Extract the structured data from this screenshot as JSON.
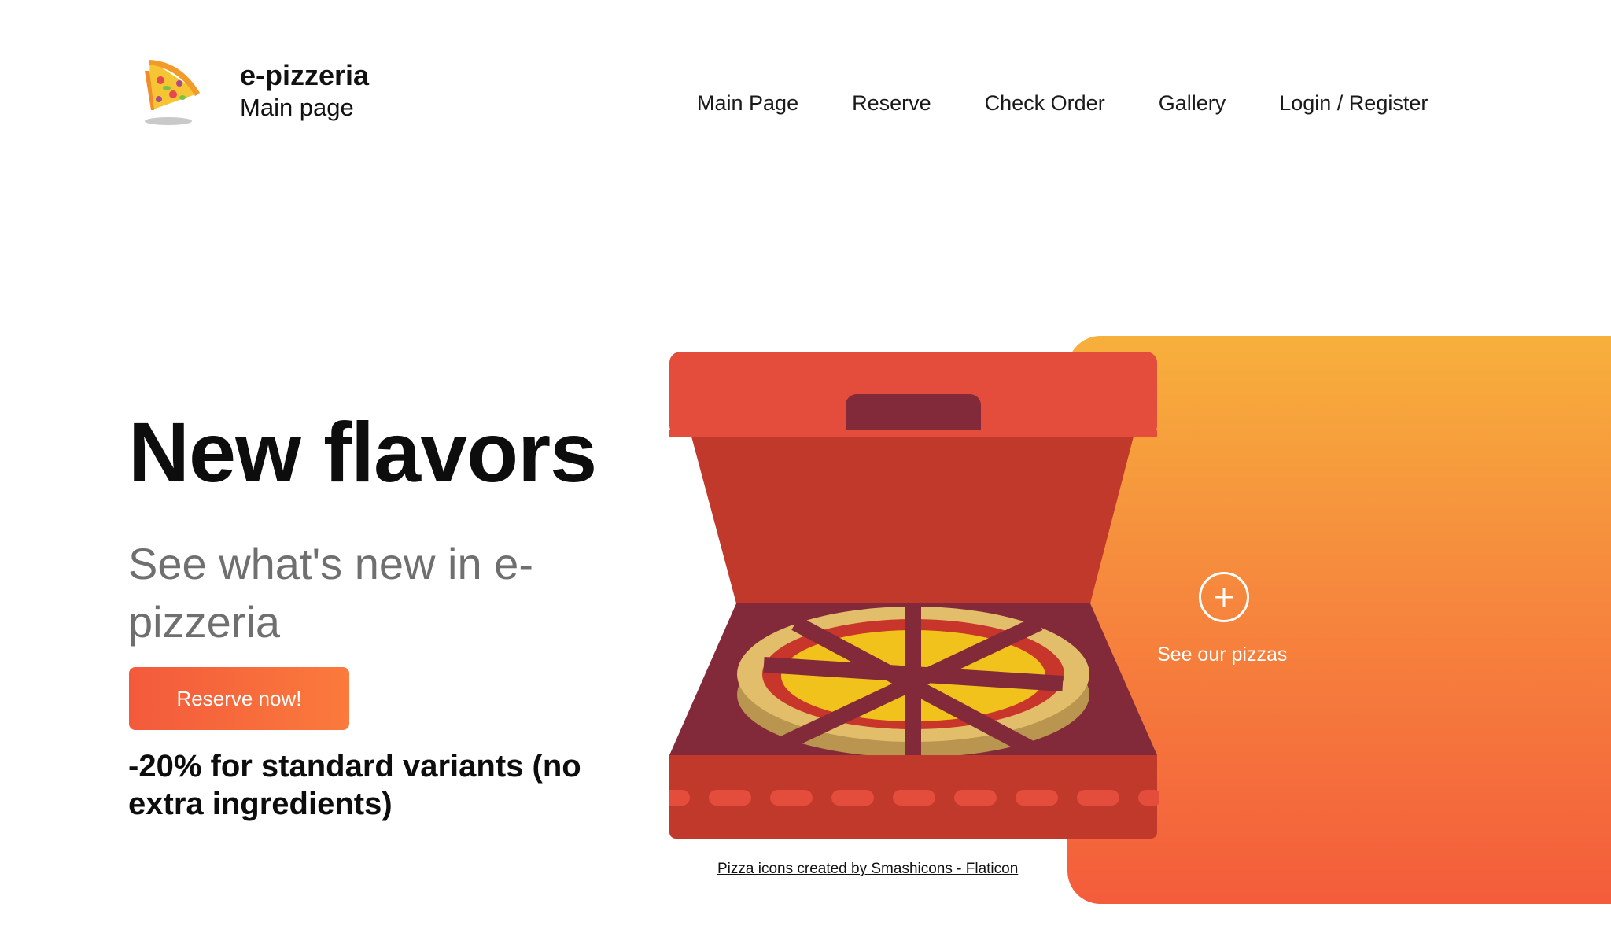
{
  "header": {
    "brand_name": "e-pizzeria",
    "brand_subtitle": "Main page",
    "logo_icon": "pizza-slice-icon"
  },
  "nav": {
    "items": [
      {
        "label": "Main Page"
      },
      {
        "label": "Reserve"
      },
      {
        "label": "Check Order"
      },
      {
        "label": "Gallery"
      },
      {
        "label": "Login / Register"
      }
    ]
  },
  "hero": {
    "title": "New flavors",
    "subtitle": "See what's new in e-pizzeria",
    "cta_label": "Reserve now!",
    "promo": "-20% for standard variants (no extra ingredients)"
  },
  "panel": {
    "link_label": "See our pizzas",
    "icon": "plus-circle-icon"
  },
  "illustration": {
    "icon": "pizza-box-icon",
    "credit": "Pizza icons created by Smashicons - Flaticon"
  },
  "colors": {
    "accent_start": "#f35a3c",
    "accent_end": "#fb7a3c",
    "panel_top": "#f7b03c",
    "panel_bottom": "#f45c3b",
    "box_red": "#e44c3c",
    "box_dark": "#822a3a"
  }
}
